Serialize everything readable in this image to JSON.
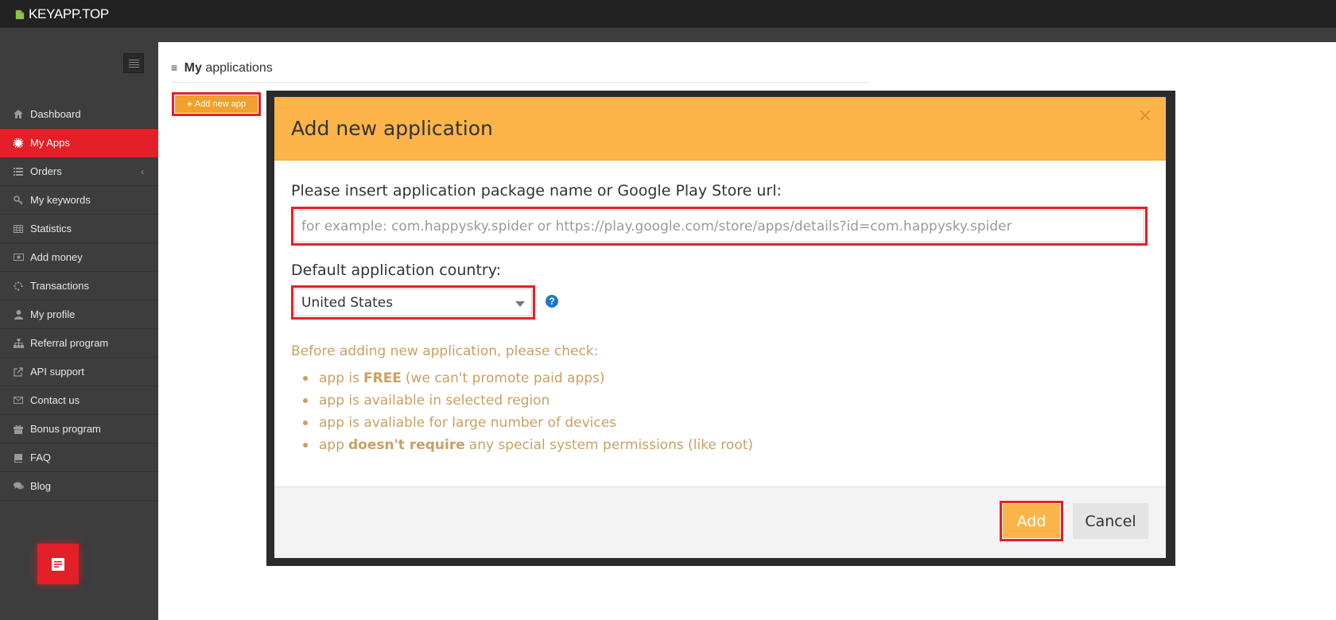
{
  "app": {
    "name": "KEYAPP.TOP",
    "logo_icon": "android-icon"
  },
  "sidebar": {
    "items": [
      {
        "label": "Dashboard",
        "icon": "home-icon",
        "active": false
      },
      {
        "label": "My Apps",
        "icon": "cog-icon",
        "active": true
      },
      {
        "label": "Orders",
        "icon": "list-icon",
        "active": false,
        "has_chevron": true
      },
      {
        "label": "My keywords",
        "icon": "key-icon",
        "active": false
      },
      {
        "label": "Statistics",
        "icon": "table-icon",
        "active": false
      },
      {
        "label": "Add money",
        "icon": "money-icon",
        "active": false
      },
      {
        "label": "Transactions",
        "icon": "spinner-icon",
        "active": false
      },
      {
        "label": "My profile",
        "icon": "user-icon",
        "active": false
      },
      {
        "label": "Referral program",
        "icon": "sitemap-icon",
        "active": false
      },
      {
        "label": "API support",
        "icon": "external-link-icon",
        "active": false
      },
      {
        "label": "Contact us",
        "icon": "envelope-icon",
        "active": false
      },
      {
        "label": "Bonus program",
        "icon": "gift-icon",
        "active": false
      },
      {
        "label": "FAQ",
        "icon": "book-icon",
        "active": false
      },
      {
        "label": "Blog",
        "icon": "comments-icon",
        "active": false
      }
    ],
    "chevron": "‹"
  },
  "main": {
    "title_bold": "My",
    "title_rest": "applications",
    "add_new_label": "Add new app"
  },
  "modal": {
    "title": "Add new application",
    "close": "×",
    "package_label": "Please insert application package name or Google Play Store url:",
    "package_placeholder": "for example: com.happysky.spider or https://play.google.com/store/apps/details?id=com.happysky.spider",
    "country_label": "Default application country:",
    "country_value": "United States",
    "help": "?",
    "check_intro": "Before adding new application, please check:",
    "checks": [
      {
        "pre": "app is",
        "bold": "FREE",
        "post": "(we can't promote paid apps)"
      },
      {
        "pre": "app is available in selected region",
        "bold": "",
        "post": ""
      },
      {
        "pre": "app is avaliable for large number of devices",
        "bold": "",
        "post": ""
      },
      {
        "pre": "app",
        "bold": "doesn't require",
        "post": "any special system permissions (like root)"
      }
    ],
    "add_label": "Add",
    "cancel_label": "Cancel"
  },
  "colors": {
    "accent_red": "#e32027",
    "modal_header": "#fdb549",
    "check_text": "#c9a063",
    "help_blue": "#1e78c8"
  }
}
